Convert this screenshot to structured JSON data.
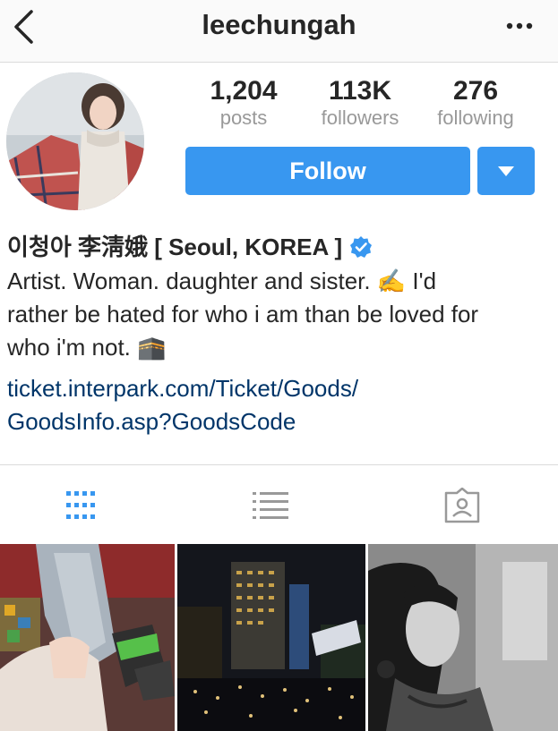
{
  "header": {
    "title": "leechungah"
  },
  "stats": [
    {
      "value": "1,204",
      "label": "posts"
    },
    {
      "value": "113K",
      "label": "followers"
    },
    {
      "value": "276",
      "label": "following"
    }
  ],
  "actions": {
    "follow_label": "Follow"
  },
  "bio": {
    "name": "이청아 李淸娥 [ Seoul, KOREA ]",
    "line1": "Artist. Woman. daughter and sister. ✍️      I'd",
    "line2": "rather be hated for who i am than be loved for",
    "line3": "who i'm not. 🕋",
    "link_line1": "ticket.interpark.com/Ticket/Goods/",
    "link_line2": "GoodsInfo.asp?GoodsCode"
  },
  "colors": {
    "accent": "#3897f0",
    "link": "#003569",
    "muted": "#999999",
    "verified": "#3897f0"
  },
  "icons": [
    "back-chevron-icon",
    "more-dots-icon",
    "dropdown-caret-icon",
    "verified-badge-icon",
    "grid-icon",
    "list-icon",
    "tagged-icon"
  ]
}
